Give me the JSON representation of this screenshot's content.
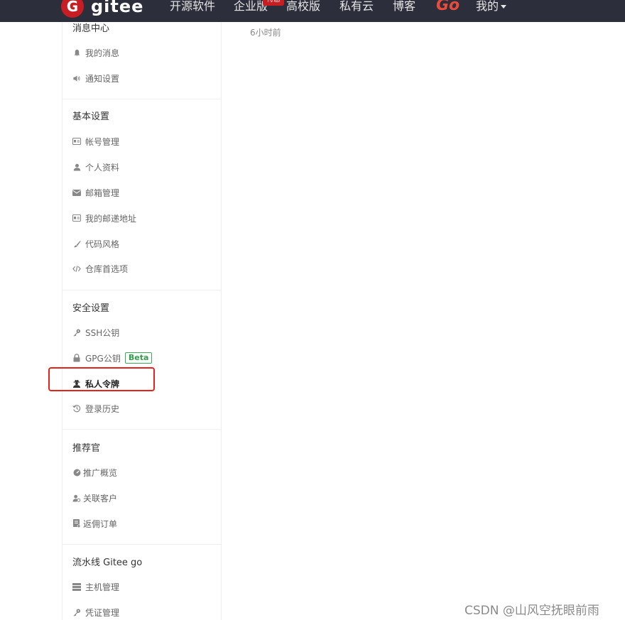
{
  "nav": {
    "logo_text": "gitee",
    "items": [
      "开源软件",
      "企业版",
      "高校版",
      "私有云",
      "博客"
    ],
    "badge": "特惠",
    "go_label": "Go",
    "mine_label": "我的"
  },
  "sidebar": {
    "sections": [
      {
        "title": "消息中心",
        "items": [
          {
            "label": "我的消息",
            "icon": "bell-icon"
          },
          {
            "label": "通知设置",
            "icon": "speaker-icon"
          }
        ]
      },
      {
        "title": "基本设置",
        "items": [
          {
            "label": "帐号管理",
            "icon": "id-card-icon"
          },
          {
            "label": "个人资料",
            "icon": "user-icon"
          },
          {
            "label": "邮箱管理",
            "icon": "envelope-icon"
          },
          {
            "label": "我的邮递地址",
            "icon": "address-card-icon"
          },
          {
            "label": "代码风格",
            "icon": "paintbrush-icon"
          },
          {
            "label": "仓库首选项",
            "icon": "code-icon"
          }
        ]
      },
      {
        "title": "安全设置",
        "items": [
          {
            "label": "SSH公钥",
            "icon": "key-icon"
          },
          {
            "label": "GPG公钥",
            "icon": "lock-icon",
            "badge": "Beta"
          },
          {
            "label": "私人令牌",
            "icon": "user-secret-icon",
            "active": true
          },
          {
            "label": "登录历史",
            "icon": "history-icon"
          }
        ]
      },
      {
        "title": "推荐官",
        "items": [
          {
            "label": "推广概览",
            "icon": "dashboard-icon"
          },
          {
            "label": "关联客户",
            "icon": "user-link-icon"
          },
          {
            "label": "返佣订单",
            "icon": "order-icon"
          }
        ]
      },
      {
        "title": "流水线 Gitee go",
        "items": [
          {
            "label": "主机管理",
            "icon": "server-icon"
          },
          {
            "label": "凭证管理",
            "icon": "key-icon"
          }
        ]
      }
    ]
  },
  "main": {
    "timestamp": "6小时前"
  },
  "watermark": "CSDN @山风空抚眼前雨"
}
